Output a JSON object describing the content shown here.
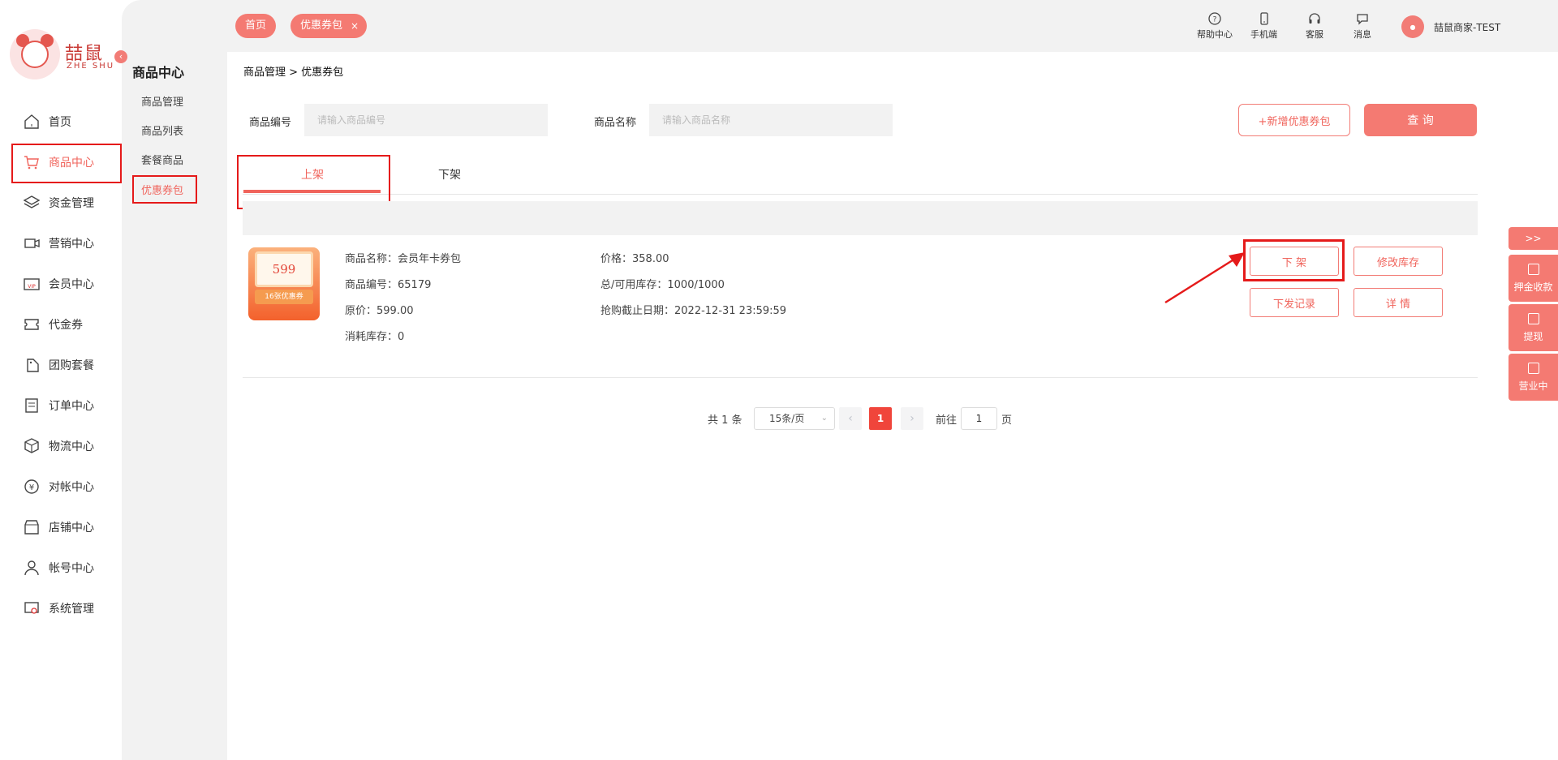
{
  "logo": {
    "cn": "喆鼠",
    "en": "ZHE SHU"
  },
  "nav": [
    {
      "label": "首页",
      "icon": "home-icon"
    },
    {
      "label": "商品中心",
      "icon": "cart-icon",
      "active": true
    },
    {
      "label": "资金管理",
      "icon": "layers-icon"
    },
    {
      "label": "营销中心",
      "icon": "marketing-icon"
    },
    {
      "label": "会员中心",
      "icon": "vip-card-icon"
    },
    {
      "label": "代金券",
      "icon": "voucher-icon"
    },
    {
      "label": "团购套餐",
      "icon": "group-buy-icon"
    },
    {
      "label": "订单中心",
      "icon": "order-icon"
    },
    {
      "label": "物流中心",
      "icon": "package-icon"
    },
    {
      "label": "对帐中心",
      "icon": "yen-icon"
    },
    {
      "label": "店铺中心",
      "icon": "store-icon"
    },
    {
      "label": "帐号中心",
      "icon": "user-icon"
    },
    {
      "label": "系统管理",
      "icon": "settings-icon"
    }
  ],
  "subnav": {
    "title": "商品中心",
    "items": [
      "商品管理",
      "商品列表",
      "套餐商品",
      "优惠券包"
    ],
    "active_index": 3
  },
  "topbar": {
    "tags": [
      {
        "label": "首页"
      },
      {
        "label": "优惠券包",
        "closable": true
      }
    ],
    "tools": [
      {
        "label": "帮助中心",
        "icon": "help-icon"
      },
      {
        "label": "手机端",
        "icon": "mobile-icon"
      },
      {
        "label": "客服",
        "icon": "headset-icon"
      },
      {
        "label": "消息",
        "icon": "message-icon"
      }
    ],
    "user_name": "喆鼠商家-TEST"
  },
  "breadcrumb": "商品管理 > 优惠券包",
  "filters": {
    "code_label": "商品编号",
    "code_placeholder": "请输入商品编号",
    "name_label": "商品名称",
    "name_placeholder": "请输入商品名称"
  },
  "buttons": {
    "add": "+新增优惠券包",
    "query": "查 询"
  },
  "tabs": [
    {
      "label": "上架",
      "active": true
    },
    {
      "label": "下架"
    }
  ],
  "product": {
    "thumb_price": "599",
    "thumb_band": "16张优惠券",
    "name": "商品名称：会员年卡券包",
    "code": "商品编号：65179",
    "original_price": "原价：599.00",
    "consumed_stock": "消耗库存：0",
    "price": "价格：358.00",
    "stock": "总/可用库存：1000/1000",
    "deadline": "抢购截止日期：2022-12-31 23:59:59",
    "actions": {
      "offline": "下 架",
      "edit_stock": "修改库存",
      "dispatch_log": "下发记录",
      "detail": "详 情"
    }
  },
  "pagination": {
    "total": "共 1 条",
    "page_size": "15条/页",
    "current": "1",
    "goto_label": "前往",
    "goto_value": "1",
    "page_unit": "页"
  },
  "float_panel": {
    "toggle": ">>",
    "items": [
      "押金收款",
      "提现",
      "营业中"
    ]
  },
  "colors": {
    "accent": "#f47a72",
    "active_text": "#f0645c",
    "highlight_box": "#e51a1a"
  }
}
